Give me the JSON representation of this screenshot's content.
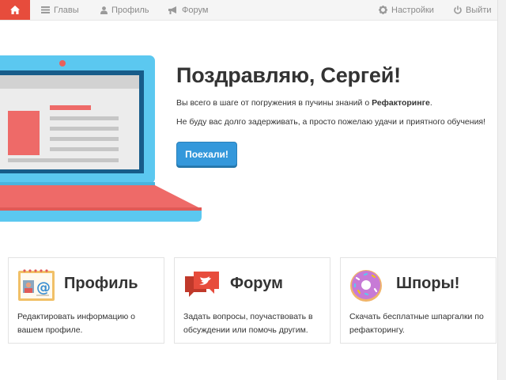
{
  "nav": {
    "items": [
      {
        "label": "Главы",
        "icon": "list-icon"
      },
      {
        "label": "Профиль",
        "icon": "user-icon"
      },
      {
        "label": "Форум",
        "icon": "megaphone-icon"
      },
      {
        "label": "Настройки",
        "icon": "gear-icon"
      },
      {
        "label": "Выйти",
        "icon": "power-icon"
      }
    ]
  },
  "hero": {
    "title": "Поздравляю, Сергей!",
    "line1_prefix": "Вы всего в шаге от погружения в пучины знаний о ",
    "line1_bold": "Рефакторинге",
    "line1_suffix": ".",
    "line2": "Не буду вас долго задерживать, а просто пожелаю удачи и приятного обучения!",
    "button": "Поехали!"
  },
  "cards": [
    {
      "title": "Профиль",
      "desc": "Редактировать информацию о вашем профиле.",
      "icon": "profile-card-icon"
    },
    {
      "title": "Форум",
      "desc": "Задать вопросы, поучаствовать в обсуждении или помочь другим.",
      "icon": "chat-bubbles-icon"
    },
    {
      "title": "Шпоры!",
      "desc": "Скачать бесплатные шпаргалки по рефакторингу.",
      "icon": "donut-icon"
    }
  ],
  "colors": {
    "accent_red": "#e74c3c",
    "button_blue": "#3498db",
    "laptop_blue": "#5bc8f0"
  }
}
